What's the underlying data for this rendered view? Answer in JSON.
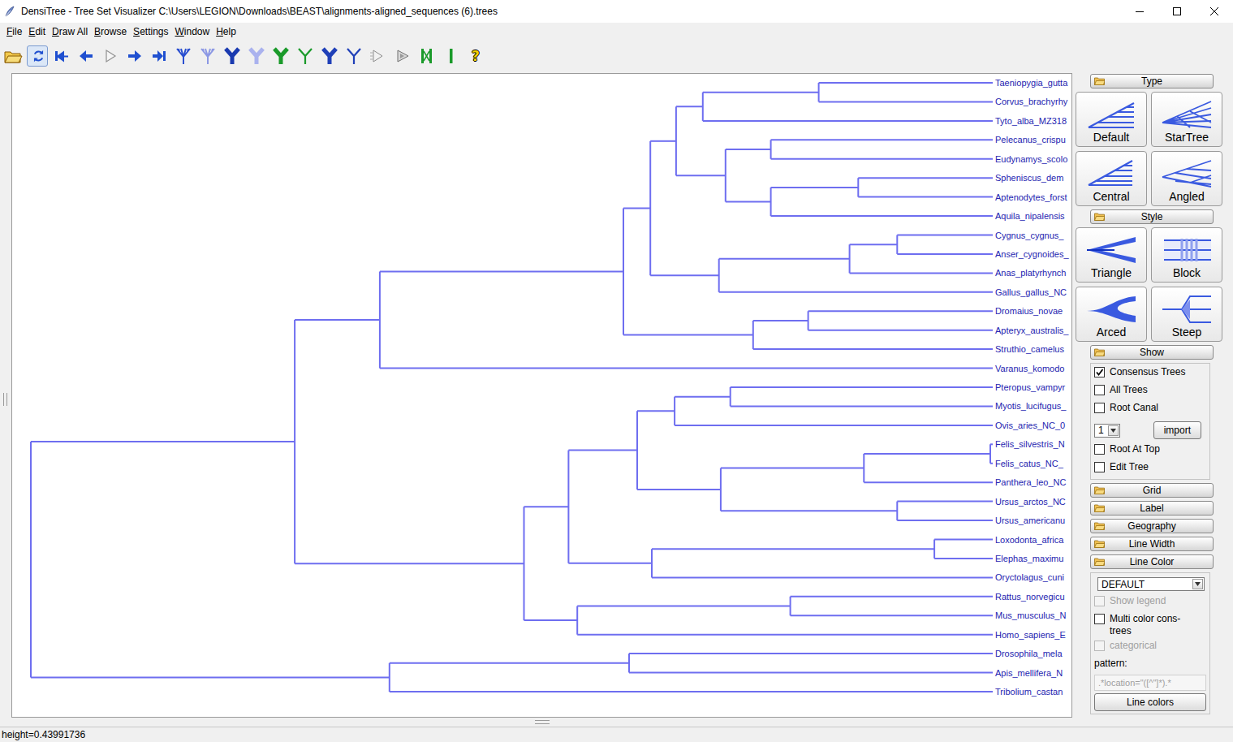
{
  "window": {
    "title": "DensiTree - Tree Set Visualizer C:\\Users\\LEGION\\Downloads\\BEAST\\alignments-aligned_sequences (6).trees"
  },
  "menu": [
    {
      "label": "File"
    },
    {
      "label": "Edit"
    },
    {
      "label": "Draw All"
    },
    {
      "label": "Browse"
    },
    {
      "label": "Settings"
    },
    {
      "label": "Window"
    },
    {
      "label": "Help"
    }
  ],
  "toolbar": [
    {
      "kind": "open",
      "selected": false
    },
    {
      "kind": "refresh",
      "selected": true
    },
    {
      "kind": "first",
      "selected": false
    },
    {
      "kind": "prev",
      "selected": false
    },
    {
      "kind": "play",
      "selected": false
    },
    {
      "kind": "next",
      "selected": false
    },
    {
      "kind": "last",
      "selected": false
    },
    {
      "kind": "split",
      "color": "#2a4fd0",
      "selected": false
    },
    {
      "kind": "split",
      "color": "#8c98e4",
      "selected": false
    },
    {
      "kind": "y",
      "color": "#1a3ab0",
      "selected": false
    },
    {
      "kind": "y",
      "color": "#aab2ee",
      "selected": false
    },
    {
      "kind": "y",
      "color": "#1a9a2a",
      "selected": false
    },
    {
      "kind": "ythin",
      "color": "#1a9a2a",
      "selected": false
    },
    {
      "kind": "y",
      "color": "#2040b8",
      "selected": false
    },
    {
      "kind": "ythin",
      "color": "#2040b8",
      "selected": false
    },
    {
      "kind": "greyarrow",
      "selected": false
    },
    {
      "kind": "greyarrow2",
      "selected": false
    },
    {
      "kind": "bars",
      "selected": false
    },
    {
      "kind": "bar",
      "selected": false
    },
    {
      "kind": "help",
      "label": "?",
      "selected": false
    }
  ],
  "tree": {
    "height": 0.4399,
    "children": [
      {
        "height": 0.3192,
        "children": [
          {
            "height": 0.2803,
            "children": [
              {
                "height": 0.1689,
                "children": [
                  {
                    "height": 0.1566,
                    "children": [
                      {
                        "height": 0.1448,
                        "children": [
                          {
                            "height": 0.1326,
                            "children": [
                              {
                                "height": 0.0796,
                                "children": [
                                  {
                                    "label": "Taeniopygia_gutta"
                                  },
                                  {
                                    "label": "Corvus_brachyrhy"
                                  }
                                ]
                              },
                              {
                                "label": "Tyto_alba_MZ318"
                              }
                            ]
                          },
                          {
                            "height": 0.1222,
                            "children": [
                              {
                                "height": 0.1015,
                                "children": [
                                  {
                                    "label": "Pelecanus_crispu"
                                  },
                                  {
                                    "label": "Eudynamys_scolo"
                                  }
                                ]
                              },
                              {
                                "height": 0.1015,
                                "children": [
                                  {
                                    "height": 0.0615,
                                    "children": [
                                      {
                                        "label": "Spheniscus_dem"
                                      },
                                      {
                                        "label": "Aptenodytes_forst"
                                      }
                                    ]
                                  },
                                  {
                                    "label": "Aquila_nipalensis"
                                  }
                                ]
                              }
                            ]
                          }
                        ]
                      },
                      {
                        "height": 0.1252,
                        "children": [
                          {
                            "height": 0.0655,
                            "children": [
                              {
                                "height": 0.0437,
                                "children": [
                                  {
                                    "label": "Cygnus_cygnus_"
                                  },
                                  {
                                    "label": "Anser_cygnoides_"
                                  }
                                ]
                              },
                              {
                                "label": "Anas_platyrhynch"
                              }
                            ]
                          },
                          {
                            "label": "Gallus_gallus_NC"
                          }
                        ]
                      }
                    ]
                  },
                  {
                    "height": 0.1096,
                    "children": [
                      {
                        "height": 0.0844,
                        "children": [
                          {
                            "label": "Dromaius_novae"
                          },
                          {
                            "label": "Apteryx_australis_"
                          }
                        ]
                      },
                      {
                        "label": "Struthio_camelus"
                      }
                    ]
                  }
                ]
              },
              {
                "label": "Varanus_komodo"
              }
            ]
          },
          {
            "height": 0.2144,
            "children": [
              {
                "height": 0.194,
                "children": [
                  {
                    "height": 0.1626,
                    "children": [
                      {
                        "height": 0.1455,
                        "children": [
                          {
                            "height": 0.12,
                            "children": [
                              {
                                "label": "Pteropus_vampyr"
                              },
                              {
                                "label": "Myotis_lucifugus_"
                              }
                            ]
                          },
                          {
                            "label": "Ovis_aries_NC_0"
                          }
                        ]
                      },
                      {
                        "height": 0.1244,
                        "children": [
                          {
                            "height": 0.0589,
                            "children": [
                              {
                                "height": 0.0011,
                                "children": [
                                  {
                                    "label": "Felis_silvestris_N"
                                  },
                                  {
                                    "label": "Felis_catus_NC_"
                                  }
                                ]
                              },
                              {
                                "label": "Panthera_leo_NC"
                              }
                            ]
                          },
                          {
                            "height": 0.0437,
                            "children": [
                              {
                                "label": "Ursus_arctos_NC"
                              },
                              {
                                "label": "Ursus_americanu"
                              }
                            ]
                          }
                        ]
                      }
                    ]
                  },
                  {
                    "height": 0.1559,
                    "children": [
                      {
                        "height": 0.0267,
                        "children": [
                          {
                            "label": "Loxodonta_africa"
                          },
                          {
                            "label": "Elephas_maximu"
                          }
                        ]
                      },
                      {
                        "label": "Oryctolagus_cuni"
                      }
                    ]
                  }
                ]
              },
              {
                "height": 0.19,
                "children": [
                  {
                    "height": 0.0926,
                    "children": [
                      {
                        "label": "Rattus_norvegicu"
                      },
                      {
                        "label": "Mus_musculus_N"
                      }
                    ]
                  },
                  {
                    "label": "Homo_sapiens_E"
                  }
                ]
              }
            ]
          }
        ]
      },
      {
        "height": 0.2759,
        "children": [
          {
            "height": 0.1663,
            "children": [
              {
                "label": "Drosophila_mela"
              },
              {
                "label": "Apis_mellifera_N"
              }
            ]
          },
          {
            "label": "Tribolium_castan"
          }
        ]
      }
    ]
  },
  "panel": [
    {
      "kind": "tiles",
      "header": "Type",
      "expanded": true,
      "tiles": [
        {
          "label": "Default",
          "kind": "default"
        },
        {
          "label": "StarTree",
          "kind": "startree"
        },
        {
          "label": "Central",
          "kind": "central"
        },
        {
          "label": "Angled",
          "kind": "angled"
        }
      ]
    },
    {
      "kind": "tiles",
      "header": "Style",
      "expanded": true,
      "tiles": [
        {
          "label": "Triangle",
          "kind": "triangle"
        },
        {
          "label": "Block",
          "kind": "block"
        },
        {
          "label": "Arced",
          "kind": "arced"
        },
        {
          "label": "Steep",
          "kind": "steep"
        }
      ]
    },
    {
      "kind": "controls",
      "header": "Show",
      "expanded": true,
      "items": [
        {
          "kind": "checkbox",
          "label": "Consensus Trees",
          "checked": true,
          "disabled": false
        },
        {
          "kind": "checkbox",
          "label": "All Trees",
          "checked": false,
          "disabled": false
        },
        {
          "kind": "checkbox",
          "label": "Root Canal",
          "checked": false,
          "disabled": false
        },
        {
          "kind": "select-button",
          "value": "1",
          "button": "import"
        },
        {
          "kind": "checkbox",
          "label": "Root At Top",
          "checked": false,
          "disabled": false
        },
        {
          "kind": "checkbox",
          "label": "Edit Tree",
          "checked": false,
          "disabled": false
        }
      ]
    },
    {
      "kind": "collapsed",
      "header": "Grid",
      "expanded": false
    },
    {
      "kind": "collapsed",
      "header": "Label",
      "expanded": false
    },
    {
      "kind": "collapsed",
      "header": "Geography",
      "expanded": false
    },
    {
      "kind": "collapsed",
      "header": "Line Width",
      "expanded": false
    },
    {
      "kind": "controls",
      "header": "Line Color",
      "expanded": true,
      "items": [
        {
          "kind": "select",
          "value": "DEFAULT"
        },
        {
          "kind": "checkbox",
          "label": "Show legend",
          "checked": false,
          "disabled": true
        },
        {
          "kind": "checkbox",
          "label": "Multi color cons-trees",
          "checked": false,
          "disabled": false
        },
        {
          "kind": "checkbox",
          "label": "categorical",
          "checked": false,
          "disabled": true
        },
        {
          "kind": "label",
          "label": "pattern:"
        },
        {
          "kind": "field",
          "value": ".*location=\"([^\"]*).*",
          "disabled": true
        },
        {
          "kind": "button",
          "label": "Line colors"
        }
      ]
    }
  ],
  "status_bar": "height=0.43991736"
}
